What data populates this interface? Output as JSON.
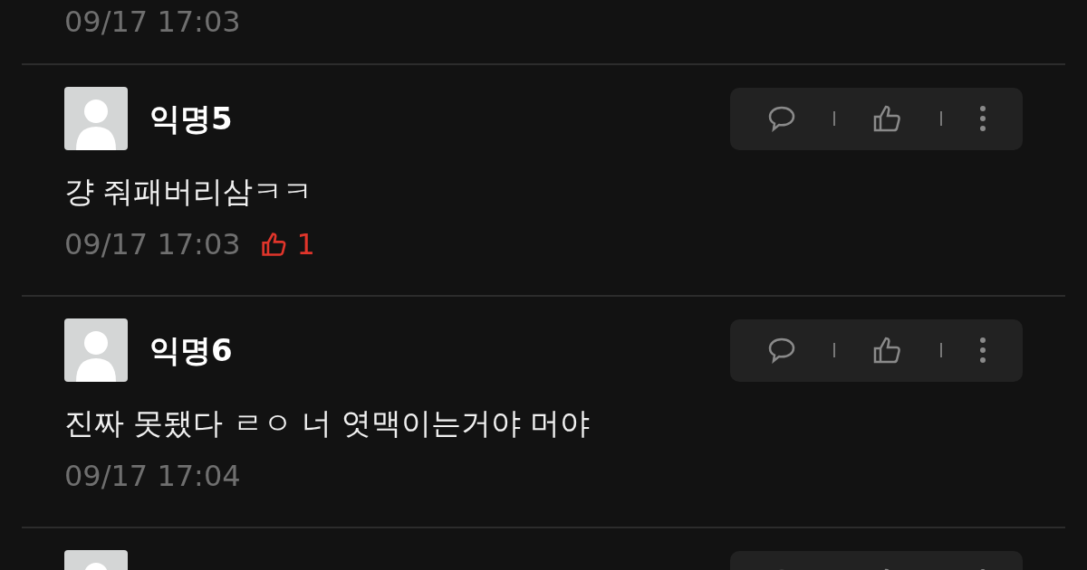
{
  "top_timestamp": "09/17 17:03",
  "comments": [
    {
      "kind": "full",
      "author": "익명5",
      "text": "걍 줘패버리삼ㅋㅋ",
      "time": "09/17 17:03",
      "likes": "1"
    },
    {
      "kind": "full",
      "author": "익명6",
      "text": "진짜 못됐다 ㄹㅇ 너 엿맥이는거야 머야",
      "time": "09/17 17:04"
    },
    {
      "kind": "cut_off"
    }
  ]
}
